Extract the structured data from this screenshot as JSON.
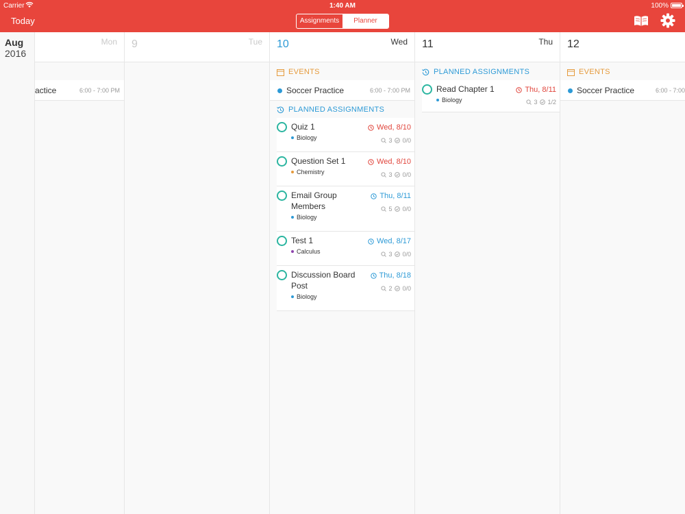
{
  "status": {
    "carrier": "Carrier",
    "time": "1:40 AM",
    "battery": "100%"
  },
  "nav": {
    "today": "Today",
    "segments": [
      "Assignments",
      "Planner"
    ],
    "active_segment": "Planner"
  },
  "colors": {
    "accent": "#e8453c",
    "blue": "#2d9ad6",
    "orange": "#e59a3c",
    "teal": "#2bb5a0",
    "biology": "#2d9ad6",
    "chemistry": "#e59a3c",
    "calculus": "#8e44ad"
  },
  "month": {
    "name": "Aug",
    "year": "2016"
  },
  "days": [
    {
      "num": "",
      "weekday": "Mon"
    },
    {
      "num": "9",
      "weekday": "Tue"
    },
    {
      "num": "10",
      "weekday": "Wed"
    },
    {
      "num": "11",
      "weekday": "Thu"
    },
    {
      "num": "12",
      "weekday": ""
    }
  ],
  "mon": {
    "event": {
      "title": "actice",
      "time": "6:00 - 7:00 PM"
    }
  },
  "wed": {
    "events_label": "EVENTS",
    "event": {
      "title": "Soccer Practice",
      "time": "6:00 - 7:00 PM"
    },
    "planned_label": "PLANNED ASSIGNMENTS",
    "assignments": [
      {
        "title": "Quiz 1",
        "subject": "Biology",
        "due": "Wed, 8/10",
        "resources": "3",
        "progress": "0/0"
      },
      {
        "title": "Question Set 1",
        "subject": "Chemistry",
        "due": "Wed, 8/10",
        "resources": "3",
        "progress": "0/0"
      },
      {
        "title": "Email Group Members",
        "subject": "Biology",
        "due": "Thu, 8/11",
        "resources": "5",
        "progress": "0/0"
      },
      {
        "title": "Test 1",
        "subject": "Calculus",
        "due": "Wed, 8/17",
        "resources": "3",
        "progress": "0/0"
      },
      {
        "title": "Discussion Board Post",
        "subject": "Biology",
        "due": "Thu, 8/18",
        "resources": "2",
        "progress": "0/0"
      }
    ]
  },
  "thu": {
    "planned_label": "PLANNED ASSIGNMENTS",
    "assignment": {
      "title": "Read Chapter 1",
      "subject": "Biology",
      "due": "Thu, 8/11",
      "resources": "3",
      "progress": "1/2"
    }
  },
  "fri": {
    "events_label": "EVENTS",
    "event": {
      "title": "Soccer Practice",
      "time": "6:00 - 7:00"
    }
  }
}
